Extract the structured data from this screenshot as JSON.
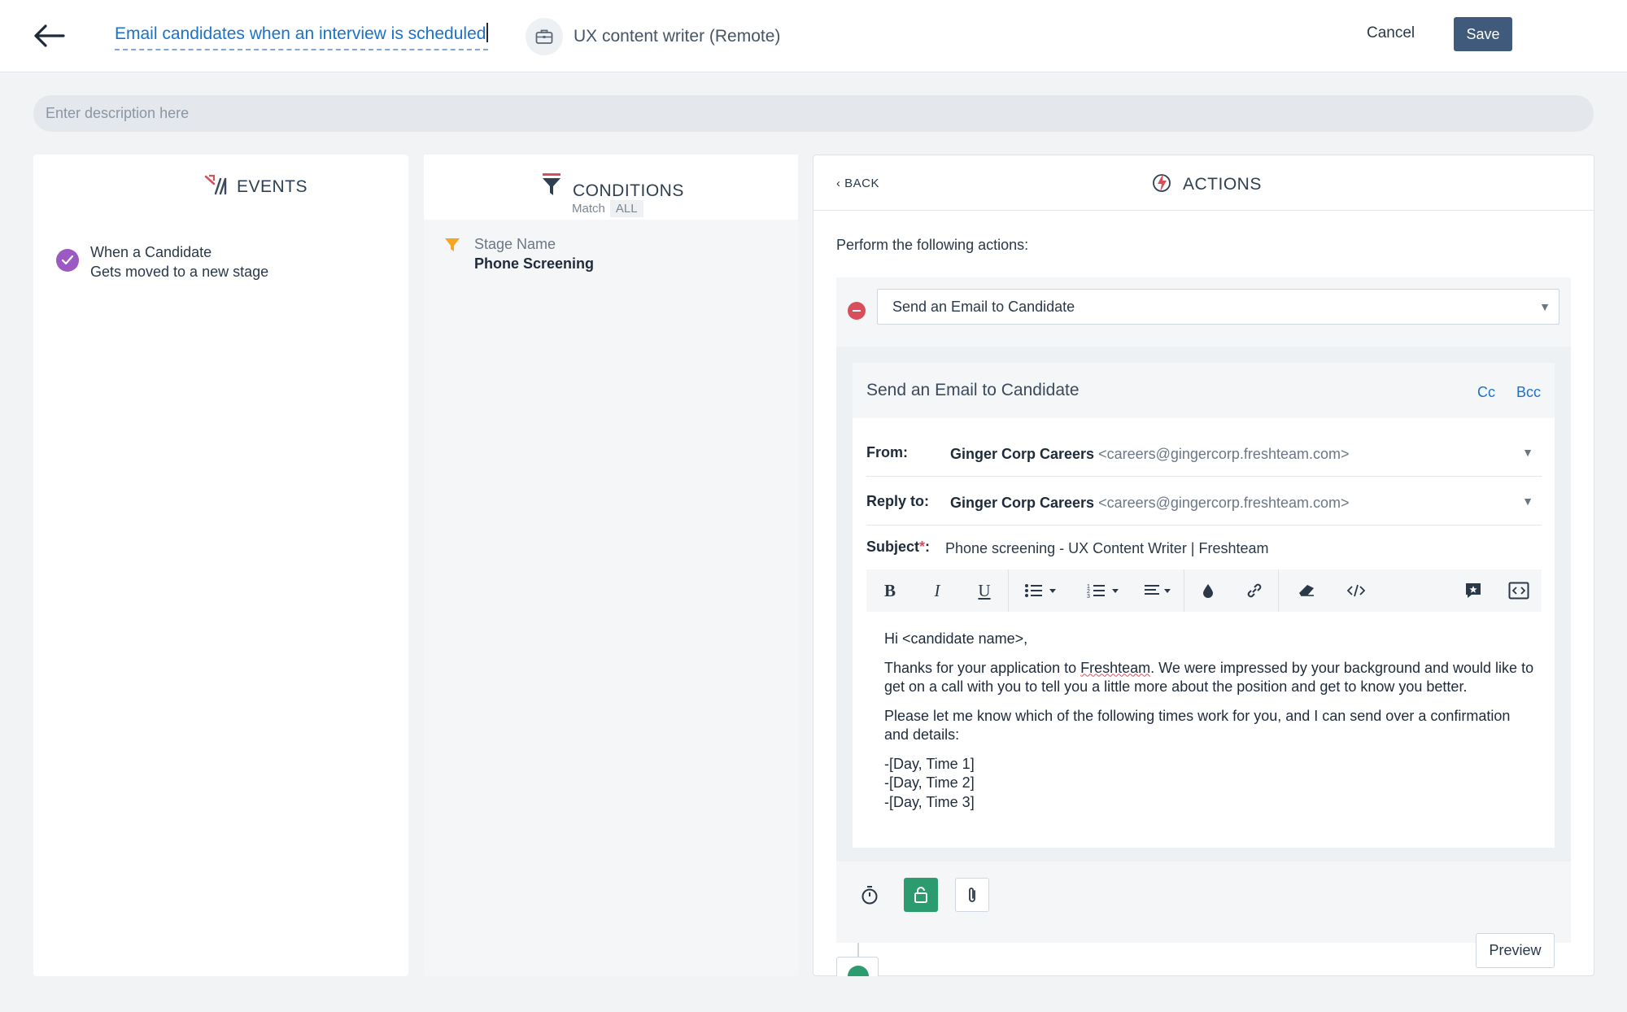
{
  "header": {
    "rule_title": "Email candidates when an interview is scheduled",
    "job_name": "UX content writer (Remote)",
    "cancel_label": "Cancel",
    "save_label": "Save"
  },
  "description": {
    "placeholder": "Enter description here"
  },
  "events": {
    "title": "EVENTS",
    "item": {
      "line1": "When a Candidate",
      "line2": "Gets moved to a new stage"
    }
  },
  "conditions": {
    "title": "CONDITIONS",
    "match_label": "Match",
    "match_value": "ALL",
    "item": {
      "label": "Stage Name",
      "value": "Phone Screening"
    }
  },
  "actions": {
    "back_label": "BACK",
    "title": "ACTIONS",
    "perform_text": "Perform the following actions:",
    "selected_action": "Send an Email to Candidate",
    "email": {
      "title": "Send an Email to Candidate",
      "cc_label": "Cc",
      "bcc_label": "Bcc",
      "from_label": "From:",
      "from_name": "Ginger Corp Careers",
      "from_address": "<careers@gingercorp.freshteam.com>",
      "reply_label": "Reply to:",
      "reply_name": "Ginger Corp Careers",
      "reply_address": "<careers@gingercorp.freshteam.com>",
      "subject_label": "Subject",
      "subject_required": "*",
      "subject_colon": ":",
      "subject_value": "Phone screening - UX Content Writer | Freshteam",
      "toolbar": {
        "bold": "B",
        "italic": "I",
        "underline": "U"
      },
      "body": {
        "greeting": "Hi <candidate name>,",
        "p1_before": "Thanks for your application to ",
        "p1_brand": "Freshteam",
        "p1_after": ". We were impressed by your background and would like to get on a call with you to tell you a little more about the position and get to know you better.",
        "p2": "Please let me know which of the following times work for you, and I can send over a confirmation and details:",
        "times": [
          "-[Day, Time 1]",
          "-[Day, Time 2]",
          "-[Day, Time 3]"
        ]
      }
    },
    "preview_label": "Preview"
  },
  "colors": {
    "primary_blue": "#1a73c8",
    "save_bg": "#3f5a7a",
    "event_check": "#9b59c3",
    "remove_red": "#d84f5c",
    "lock_green": "#2c9b6e",
    "condition_funnel": "#f5a623"
  }
}
